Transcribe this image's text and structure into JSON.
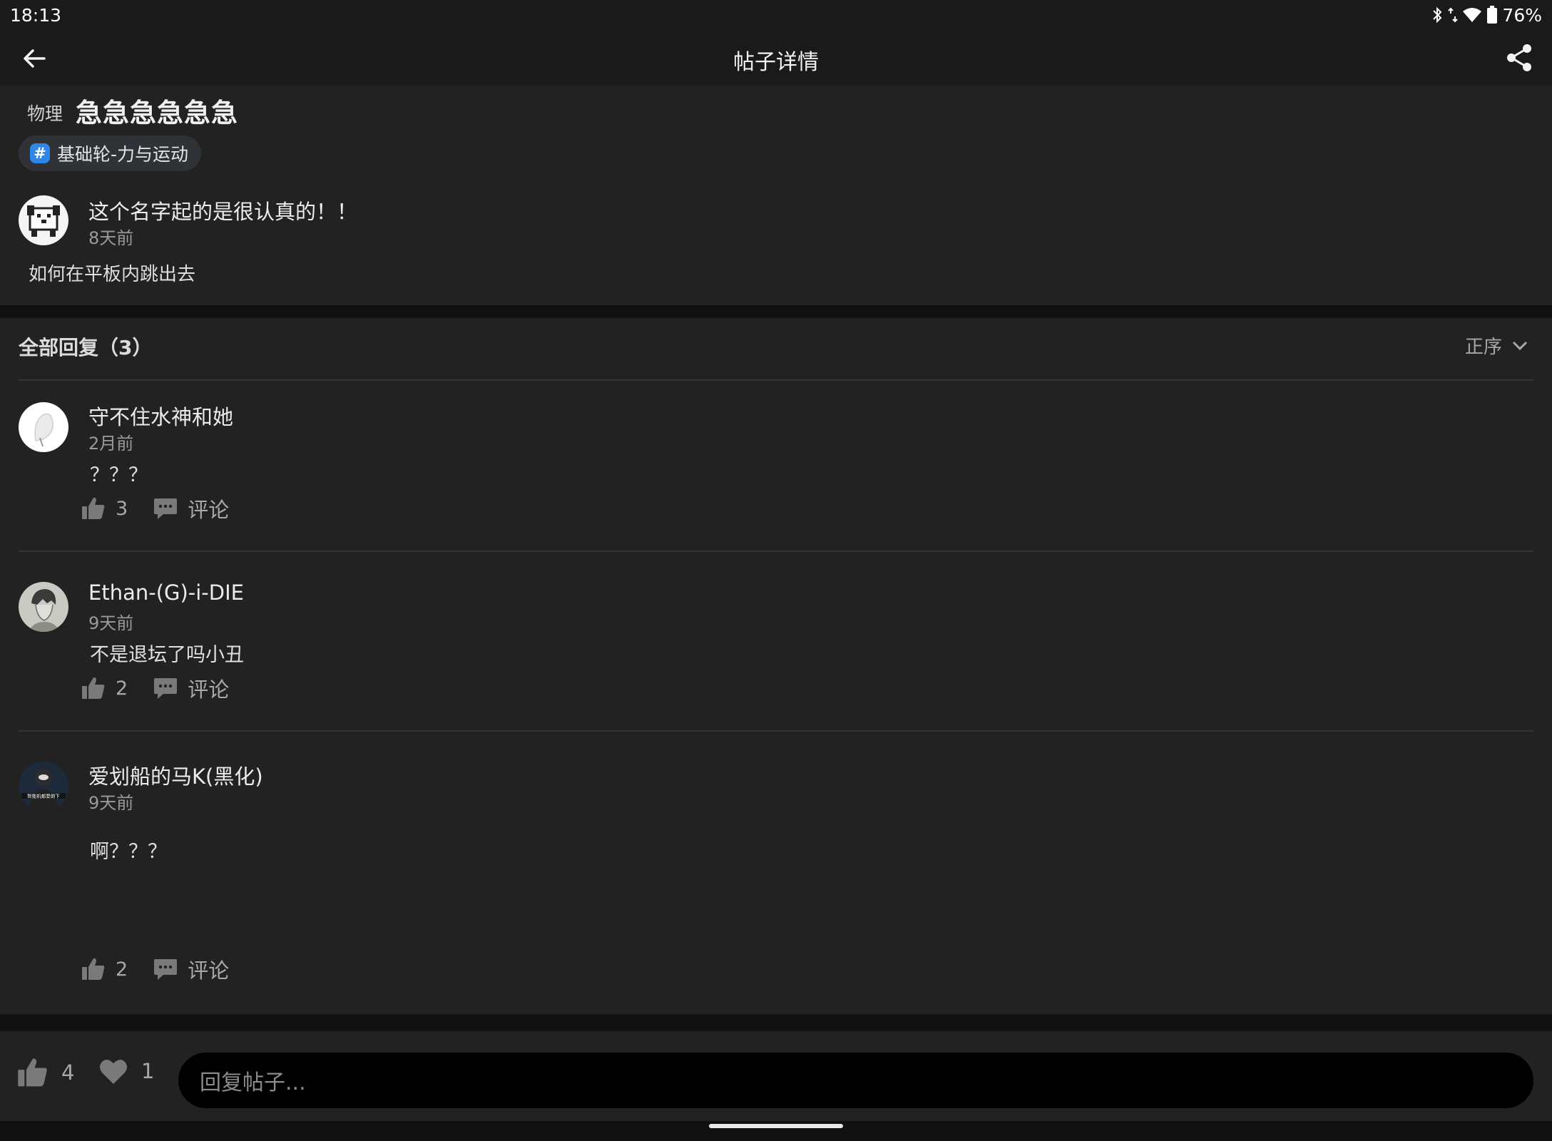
{
  "status_bar": {
    "time": "18:13",
    "battery": "76%",
    "icons": [
      "bluetooth-icon",
      "data-arrows-icon",
      "wifi-icon",
      "battery-icon"
    ]
  },
  "app_bar": {
    "title": "帖子详情",
    "back_icon": "arrow-left-icon",
    "share_icon": "share-icon"
  },
  "post": {
    "subject": "物理",
    "title": "急急急急急急",
    "topic": "基础轮-力与运动",
    "topic_icon": "#",
    "author": {
      "name": "这个名字起的是很认真的！！",
      "time": "8天前"
    },
    "body": "如何在平板内跳出去"
  },
  "replies": {
    "header": "全部回复（3）",
    "sort_label": "正序",
    "comment_label": "评论",
    "items": [
      {
        "name": "守不住水神和她",
        "time": "2月前",
        "content": "？？？",
        "likes": "3"
      },
      {
        "name": "Ethan-(G)-i-DIE",
        "time": "9天前",
        "content": "不是退坛了吗小丑",
        "likes": "2"
      },
      {
        "name": "爱划船的马K(黑化)",
        "time": "9天前",
        "content": "啊？？？",
        "likes": "2",
        "avatar_caption": "智能机都要倒下"
      }
    ]
  },
  "bottom_bar": {
    "likes": "4",
    "favorites": "1",
    "input_placeholder": "回复帖子..."
  },
  "colors": {
    "background": "#111111",
    "panel": "#222222",
    "bar": "#1a1a1a",
    "accent": "#2e86e6",
    "muted": "#9a9a9a"
  }
}
